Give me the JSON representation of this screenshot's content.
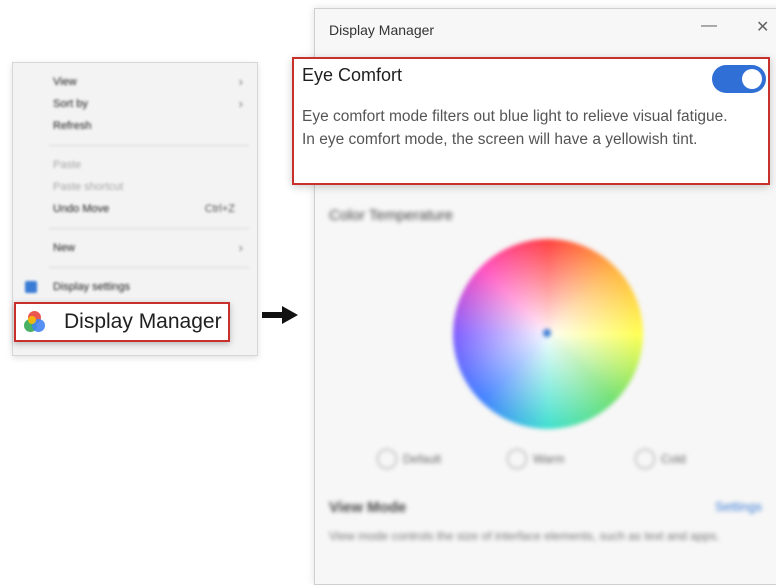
{
  "context_menu": {
    "items": [
      {
        "label": "View",
        "disabled": false,
        "arrow": true,
        "shortcut": ""
      },
      {
        "label": "Sort by",
        "disabled": false,
        "arrow": true,
        "shortcut": ""
      },
      {
        "label": "Refresh",
        "disabled": false,
        "arrow": false,
        "shortcut": ""
      },
      {
        "label": "Paste",
        "disabled": true,
        "arrow": false,
        "shortcut": ""
      },
      {
        "label": "Paste shortcut",
        "disabled": true,
        "arrow": false,
        "shortcut": ""
      },
      {
        "label": "Undo Move",
        "disabled": false,
        "arrow": false,
        "shortcut": "Ctrl+Z"
      },
      {
        "label": "New",
        "disabled": false,
        "arrow": true,
        "shortcut": ""
      },
      {
        "label": "Display settings",
        "disabled": false,
        "arrow": false,
        "shortcut": ""
      }
    ],
    "highlighted_label": "Display Manager"
  },
  "window": {
    "title": "Display Manager",
    "minimize_glyph": "—",
    "close_glyph": "✕",
    "eye_comfort": {
      "title": "Eye Comfort",
      "enabled": true,
      "description_line1": "Eye comfort mode filters out blue light to relieve visual fatigue.",
      "description_line2": "In eye comfort mode, the screen will have a yellowish tint."
    },
    "color_temperature": {
      "label": "Color Temperature",
      "options": [
        "Default",
        "Warm",
        "Cold"
      ]
    },
    "view_mode": {
      "label": "View Mode",
      "settings_link": "Settings",
      "description": "View mode controls the size of interface elements, such as text and apps."
    }
  },
  "colors": {
    "highlight_border": "#c8302c",
    "toggle_on": "#2f6fd6",
    "link": "#3a7bd5"
  }
}
